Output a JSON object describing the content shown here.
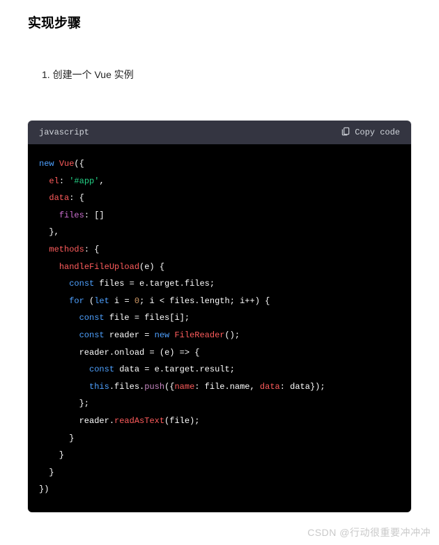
{
  "heading": "实现步骤",
  "list": {
    "items": [
      {
        "num": "1.",
        "text": "创建一个 Vue 实例"
      }
    ]
  },
  "codeBlock": {
    "language": "javascript",
    "copyLabel": "Copy code",
    "lines": [
      [
        {
          "t": "new ",
          "c": "tok-kw"
        },
        {
          "t": "Vue",
          "c": "tok-class"
        },
        {
          "t": "({",
          "c": "tok-punc"
        }
      ],
      [
        {
          "t": "  ",
          "c": ""
        },
        {
          "t": "el",
          "c": "tok-key"
        },
        {
          "t": ": ",
          "c": "tok-punc"
        },
        {
          "t": "'#app'",
          "c": "tok-str"
        },
        {
          "t": ",",
          "c": "tok-punc"
        }
      ],
      [
        {
          "t": "  ",
          "c": ""
        },
        {
          "t": "data",
          "c": "tok-key"
        },
        {
          "t": ": {",
          "c": "tok-punc"
        }
      ],
      [
        {
          "t": "    ",
          "c": ""
        },
        {
          "t": "files",
          "c": "tok-filesprop"
        },
        {
          "t": ": []",
          "c": "tok-punc"
        }
      ],
      [
        {
          "t": "  },",
          "c": "tok-punc"
        }
      ],
      [
        {
          "t": "  ",
          "c": ""
        },
        {
          "t": "methods",
          "c": "tok-key"
        },
        {
          "t": ": {",
          "c": "tok-punc"
        }
      ],
      [
        {
          "t": "    ",
          "c": ""
        },
        {
          "t": "handleFileUpload",
          "c": "tok-fn"
        },
        {
          "t": "(e) {",
          "c": "tok-punc"
        }
      ],
      [
        {
          "t": "      ",
          "c": ""
        },
        {
          "t": "const",
          "c": "tok-kw"
        },
        {
          "t": " files = e.",
          "c": "tok-prop"
        },
        {
          "t": "target",
          "c": "tok-prop"
        },
        {
          "t": ".",
          "c": "tok-punc"
        },
        {
          "t": "files",
          "c": "tok-prop"
        },
        {
          "t": ";",
          "c": "tok-punc"
        }
      ],
      [
        {
          "t": "      ",
          "c": ""
        },
        {
          "t": "for",
          "c": "tok-kw"
        },
        {
          "t": " (",
          "c": "tok-punc"
        },
        {
          "t": "let",
          "c": "tok-kw"
        },
        {
          "t": " i = ",
          "c": "tok-prop"
        },
        {
          "t": "0",
          "c": "tok-num"
        },
        {
          "t": "; i < files.",
          "c": "tok-prop"
        },
        {
          "t": "length",
          "c": "tok-prop"
        },
        {
          "t": "; i++) {",
          "c": "tok-punc"
        }
      ],
      [
        {
          "t": "        ",
          "c": ""
        },
        {
          "t": "const",
          "c": "tok-kw"
        },
        {
          "t": " file = files[i];",
          "c": "tok-prop"
        }
      ],
      [
        {
          "t": "        ",
          "c": ""
        },
        {
          "t": "const",
          "c": "tok-kw"
        },
        {
          "t": " reader = ",
          "c": "tok-prop"
        },
        {
          "t": "new ",
          "c": "tok-kw"
        },
        {
          "t": "FileReader",
          "c": "tok-class"
        },
        {
          "t": "();",
          "c": "tok-punc"
        }
      ],
      [
        {
          "t": "        reader.",
          "c": "tok-prop"
        },
        {
          "t": "onload",
          "c": "tok-prop"
        },
        {
          "t": " = (",
          "c": "tok-punc"
        },
        {
          "t": "e",
          "c": "tok-prop"
        },
        {
          "t": ") => {",
          "c": "tok-punc"
        }
      ],
      [
        {
          "t": "          ",
          "c": ""
        },
        {
          "t": "const",
          "c": "tok-kw"
        },
        {
          "t": " data = e.",
          "c": "tok-prop"
        },
        {
          "t": "target",
          "c": "tok-prop"
        },
        {
          "t": ".",
          "c": "tok-punc"
        },
        {
          "t": "result",
          "c": "tok-prop"
        },
        {
          "t": ";",
          "c": "tok-punc"
        }
      ],
      [
        {
          "t": "          ",
          "c": ""
        },
        {
          "t": "this",
          "c": "tok-kw"
        },
        {
          "t": ".",
          "c": "tok-punc"
        },
        {
          "t": "files",
          "c": "tok-prop"
        },
        {
          "t": ".",
          "c": "tok-punc"
        },
        {
          "t": "push",
          "c": "tok-push"
        },
        {
          "t": "({",
          "c": "tok-punc"
        },
        {
          "t": "name",
          "c": "tok-key"
        },
        {
          "t": ": file.",
          "c": "tok-prop"
        },
        {
          "t": "name",
          "c": "tok-prop"
        },
        {
          "t": ", ",
          "c": "tok-punc"
        },
        {
          "t": "data",
          "c": "tok-key"
        },
        {
          "t": ": data});",
          "c": "tok-punc"
        }
      ],
      [
        {
          "t": "        };",
          "c": "tok-punc"
        }
      ],
      [
        {
          "t": "        reader.",
          "c": "tok-prop"
        },
        {
          "t": "readAsText",
          "c": "tok-fn"
        },
        {
          "t": "(file);",
          "c": "tok-punc"
        }
      ],
      [
        {
          "t": "      }",
          "c": "tok-punc"
        }
      ],
      [
        {
          "t": "    }",
          "c": "tok-punc"
        }
      ],
      [
        {
          "t": "  }",
          "c": "tok-punc"
        }
      ],
      [
        {
          "t": "})",
          "c": "tok-punc"
        }
      ]
    ]
  },
  "watermark": "CSDN @行动很重要冲冲冲"
}
